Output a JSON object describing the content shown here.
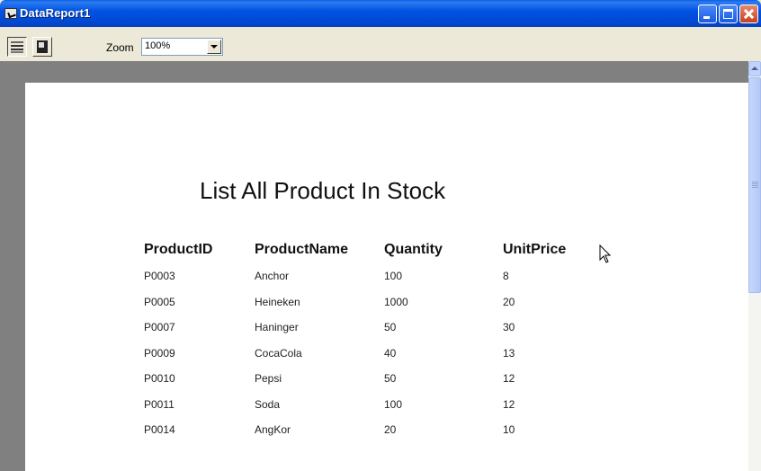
{
  "window": {
    "title": "DataReport1",
    "icon": "report-icon",
    "controls": [
      "minimize-icon",
      "maximize-icon",
      "close-icon"
    ]
  },
  "toolbar": {
    "print_icon": "print-icon",
    "export_icon": "export-icon",
    "zoom_label": "Zoom",
    "zoom_value": "100%"
  },
  "report": {
    "title": "List All Product In Stock",
    "columns": [
      "ProductID",
      "ProductName",
      "Quantity",
      "UnitPrice"
    ],
    "rows": [
      [
        "P0003",
        "Anchor",
        "100",
        "8"
      ],
      [
        "P0005",
        "Heineken",
        "1000",
        "20"
      ],
      [
        "P0007",
        "Haninger",
        "50",
        "30"
      ],
      [
        "P0009",
        "CocaCola",
        "40",
        "13"
      ],
      [
        "P0010",
        "Pepsi",
        "50",
        "12"
      ],
      [
        "P0011",
        "Soda",
        "100",
        "12"
      ],
      [
        "P0014",
        "AngKor",
        "20",
        "10"
      ]
    ]
  },
  "colors": {
    "titlebar": "#0054e3",
    "workspace": "#808080",
    "page": "#ffffff",
    "chrome": "#ece9d8"
  }
}
